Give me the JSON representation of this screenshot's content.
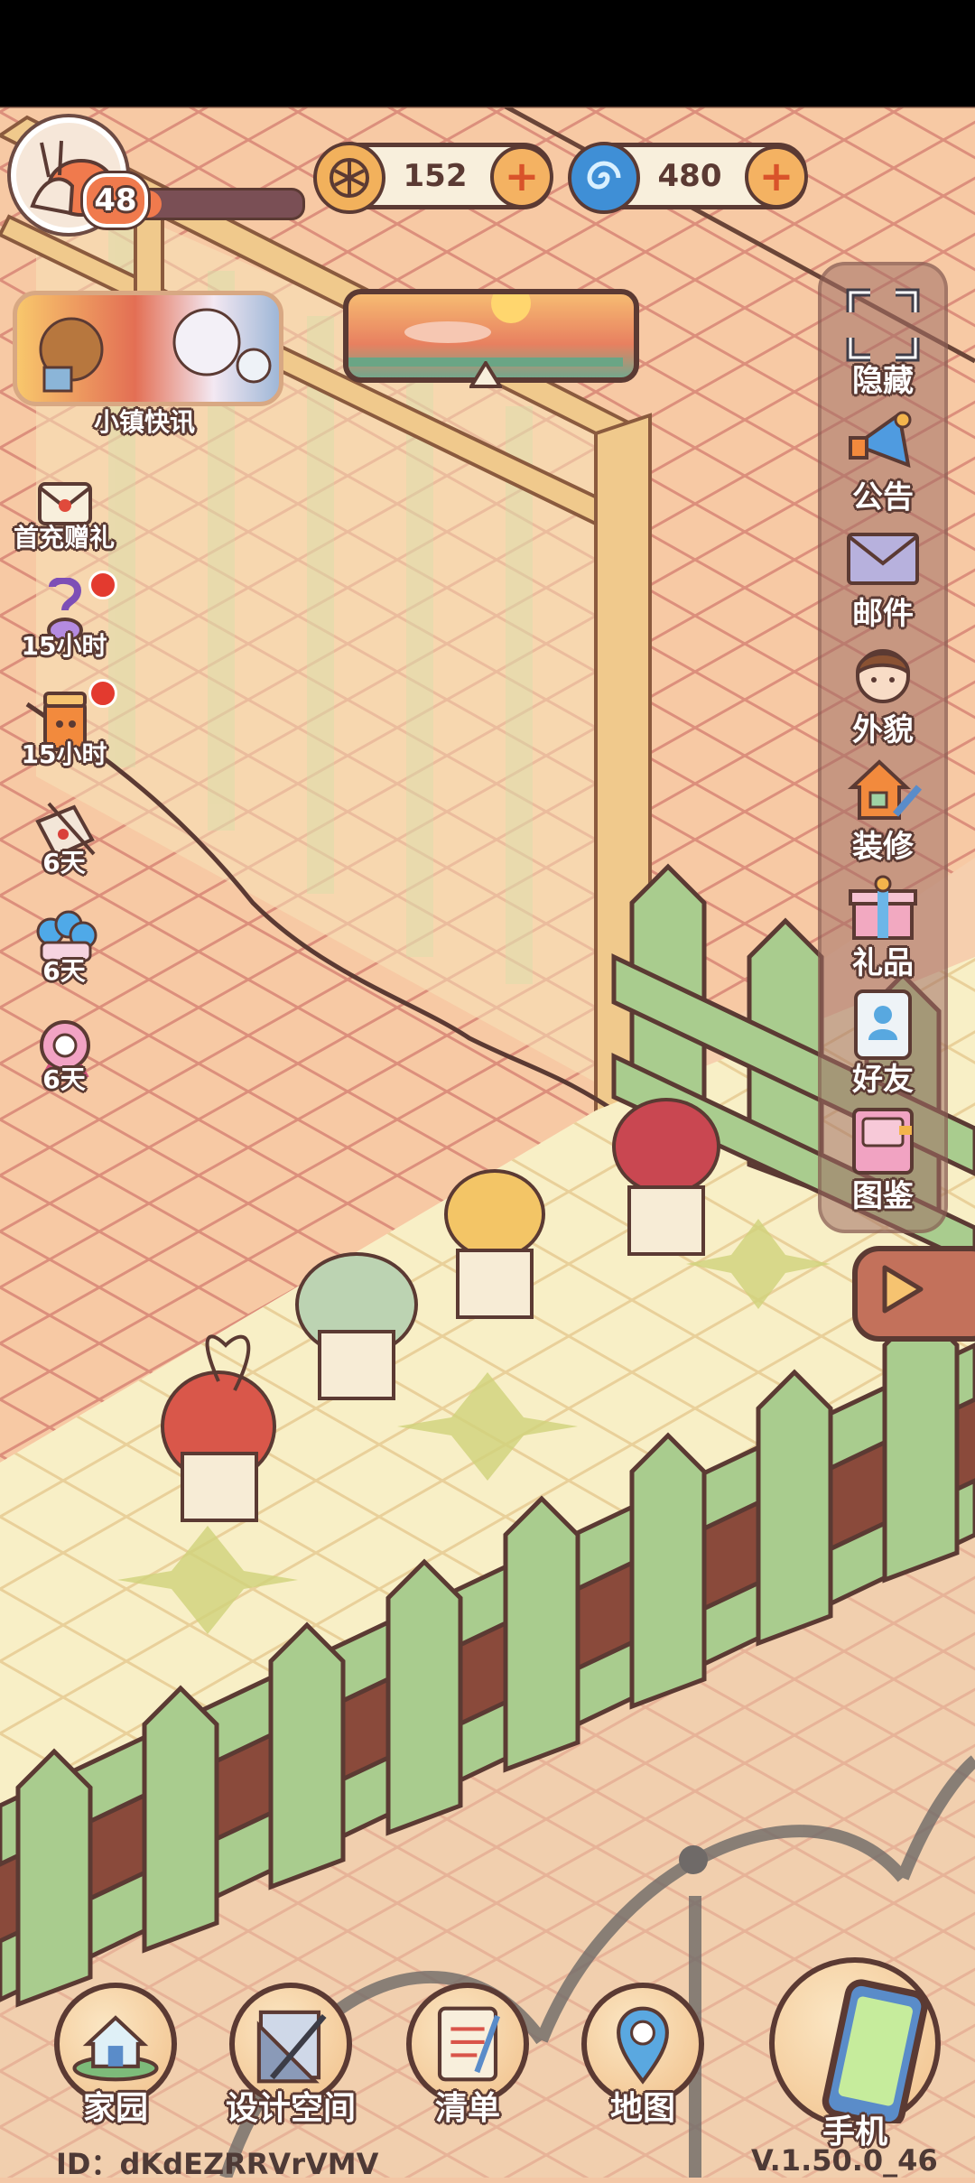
{
  "player": {
    "level": "48",
    "level_progress": 0.18
  },
  "currencies": [
    {
      "name": "coin",
      "value": "152",
      "color": "#f2b15c"
    },
    {
      "name": "spiral-gem",
      "value": "480",
      "color": "#3f8fd6"
    }
  ],
  "news": {
    "label": "小镇快讯"
  },
  "left_events": [
    {
      "label": "首充赠礼",
      "badge": false,
      "icon": "envelope-gift-icon"
    },
    {
      "label": "15小时",
      "badge": true,
      "icon": "purple-potion-icon"
    },
    {
      "label": "15小时",
      "badge": true,
      "icon": "orange-jar-icon"
    },
    {
      "label": "6天",
      "badge": false,
      "icon": "letter-quill-icon"
    },
    {
      "label": "6天",
      "badge": false,
      "icon": "blue-flowers-icon"
    },
    {
      "label": "6天",
      "badge": false,
      "icon": "pink-flower-icon"
    }
  ],
  "side_menu": [
    {
      "label": "隐藏",
      "icon": "hide-frame-icon"
    },
    {
      "label": "公告",
      "icon": "megaphone-icon"
    },
    {
      "label": "邮件",
      "icon": "mail-icon"
    },
    {
      "label": "外貌",
      "icon": "character-face-icon"
    },
    {
      "label": "装修",
      "icon": "house-wrench-icon"
    },
    {
      "label": "礼品",
      "icon": "gift-box-icon"
    },
    {
      "label": "好友",
      "icon": "friend-card-icon"
    },
    {
      "label": "图鉴",
      "icon": "album-book-icon"
    }
  ],
  "bottom_nav": [
    {
      "label": "家园",
      "icon": "home-icon"
    },
    {
      "label": "设计空间",
      "icon": "design-ruler-icon"
    },
    {
      "label": "清单",
      "icon": "checklist-icon"
    },
    {
      "label": "地图",
      "icon": "map-pin-icon"
    },
    {
      "label": "手机",
      "icon": "phone-icon"
    }
  ],
  "footer": {
    "id": "ID：dKdEZRRVrVMV",
    "version": "V.1.50.0_46"
  }
}
